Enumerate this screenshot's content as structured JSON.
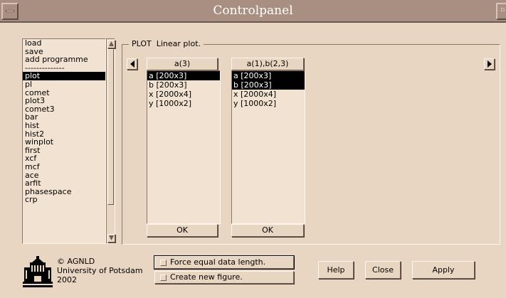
{
  "window": {
    "title": "Controlpanel"
  },
  "function_list": {
    "items": [
      "load",
      "save",
      "add programme",
      "--------------",
      "plot",
      "pl",
      "comet",
      "plot3",
      "comet3",
      "bar",
      "hist",
      "hist2",
      "winplot",
      "first",
      "xcf",
      "mcf",
      "ace",
      "arfit",
      "phasespace",
      "crp"
    ],
    "selected": "plot"
  },
  "plot_panel": {
    "legend": "PLOT  Linear plot.",
    "columns": [
      {
        "header": "a(3)",
        "items": [
          "a [200x3]",
          "b [200x3]",
          "x [2000x4]",
          "y [1000x2]"
        ],
        "selected": [
          "a [200x3]"
        ],
        "ok_label": "OK"
      },
      {
        "header": "a(1),b(2,3)",
        "items": [
          "a [200x3]",
          "b [200x3]",
          "x [2000x4]",
          "y [1000x2]"
        ],
        "selected": [
          "a [200x3]",
          "b [200x3]"
        ],
        "ok_label": "OK"
      }
    ]
  },
  "footer": {
    "credits": [
      "© AGNLD",
      "University of Potsdam",
      "2002"
    ],
    "force_equal_label": "Force equal data length.",
    "create_new_figure_label": "Create new figure.",
    "help_label": "Help",
    "close_label": "Close",
    "apply_label": "Apply"
  },
  "colors": {
    "background": "#e9d6c2",
    "titlebar": "#a88f82",
    "list_background": "#f1e2d1",
    "selection": "#000000"
  }
}
